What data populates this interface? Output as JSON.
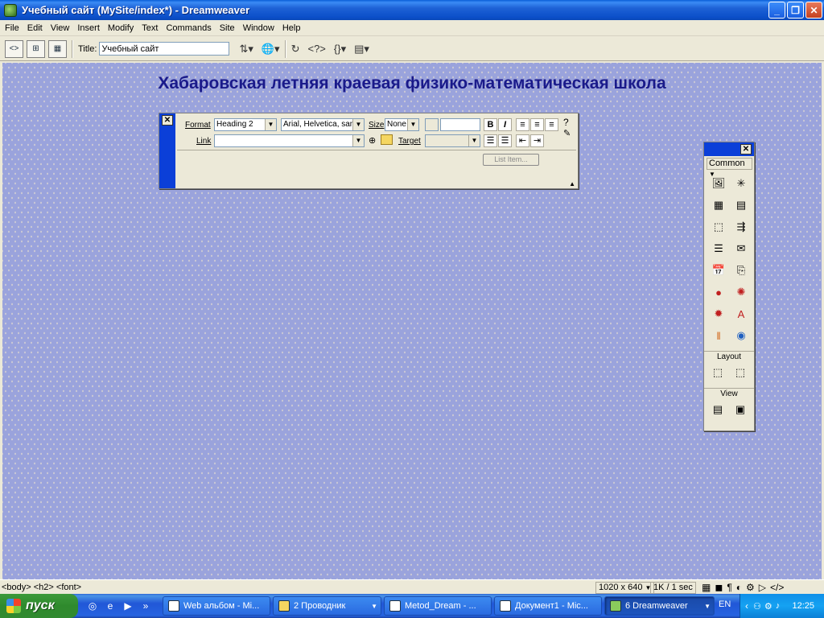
{
  "window": {
    "title": "Учебный сайт (MySite/index*) - Dreamweaver"
  },
  "menu": [
    "File",
    "Edit",
    "View",
    "Insert",
    "Modify",
    "Text",
    "Commands",
    "Site",
    "Window",
    "Help"
  ],
  "toolbar": {
    "title_label": "Title:",
    "title_value": "Учебный сайт"
  },
  "page": {
    "heading": "Хабаровская летняя краевая физико-математическая школа"
  },
  "properties": {
    "format_label": "Format",
    "format_value": "Heading 2",
    "font_value": "Arial, Helvetica, san",
    "size_label": "Size",
    "size_value": "None",
    "link_label": "Link",
    "link_value": "",
    "target_label": "Target",
    "bold": "B",
    "italic": "I",
    "list_item_button": "List Item..."
  },
  "objects_panel": {
    "category": "Common",
    "layout_label": "Layout",
    "view_label": "View"
  },
  "statusbar": {
    "tags": "<body> <h2> <font>",
    "window_size": "1020 x 640",
    "download": "1K / 1 sec"
  },
  "taskbar": {
    "start_label": "пуск",
    "tasks": [
      {
        "label": "Web альбом - Mi..."
      },
      {
        "label": "2 Проводник"
      },
      {
        "label": "Metod_Dream - ..."
      },
      {
        "label": "Документ1 - Mic..."
      },
      {
        "label": "6 Dreamweaver"
      }
    ],
    "lang": "EN",
    "clock": "12:25"
  }
}
